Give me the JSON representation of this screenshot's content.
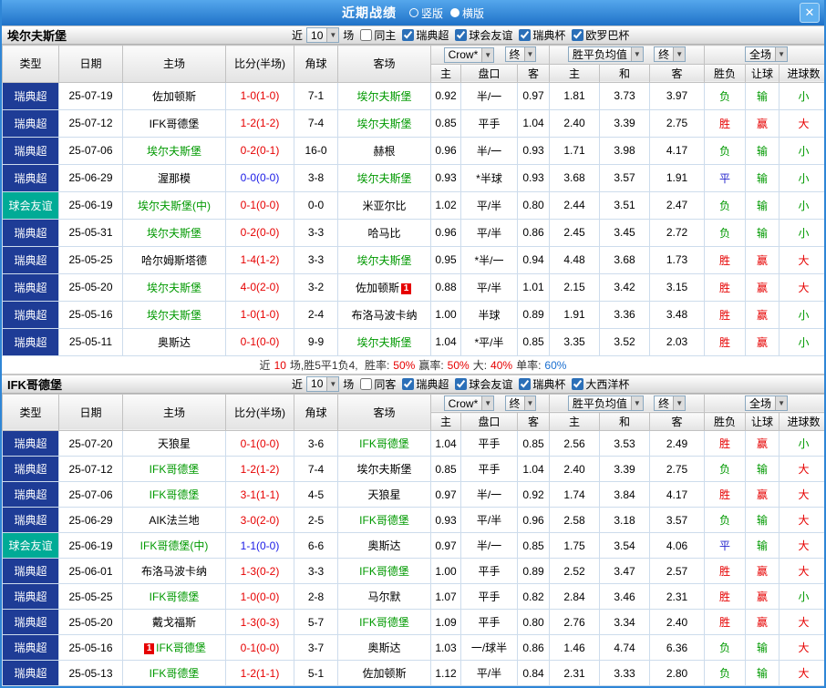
{
  "titlebar": {
    "title": "近期战绩",
    "radios": [
      {
        "label": "竖版",
        "selected": false
      },
      {
        "label": "横版",
        "selected": true
      }
    ],
    "close_label": "✕"
  },
  "colors": {
    "league_blue": "#1e3c96",
    "friendly_teal": "#00ab96",
    "focal_green": "#009900",
    "win_red": "#e60000",
    "draw_blue": "#2222cc",
    "titlebar_blue": "#1f72c8"
  },
  "columns": {
    "type": "类型",
    "date": "日期",
    "home": "主场",
    "score": "比分(半场)",
    "corner": "角球",
    "away": "客场",
    "asian_book": "Crow*",
    "asian_final": "终",
    "asian_cols": [
      "主",
      "盘口",
      "客"
    ],
    "europe_book": "胜平负均值",
    "europe_final": "终",
    "europe_cols": [
      "主",
      "和",
      "客"
    ],
    "scope": "全场",
    "result_cols": [
      "胜负",
      "让球",
      "进球数"
    ]
  },
  "sections": [
    {
      "team": "埃尔夫斯堡",
      "filter": {
        "prefix": "近",
        "count": "10",
        "suffix": "场",
        "checkboxes": [
          {
            "label": "同主",
            "checked": false
          },
          {
            "label": "瑞典超",
            "checked": true
          },
          {
            "label": "球会友谊",
            "checked": true
          },
          {
            "label": "瑞典杯",
            "checked": true
          },
          {
            "label": "欧罗巴杯",
            "checked": true
          }
        ]
      },
      "rows": [
        {
          "type": "瑞典超",
          "tc": "blue",
          "date": "25-07-19",
          "home": "佐加顿斯",
          "hf": false,
          "score": "1-0(1-0)",
          "sc": "red",
          "corner": "7-1",
          "away": "埃尔夫斯堡",
          "af": true,
          "odds": [
            "0.92",
            "半/一",
            "0.97",
            "1.81",
            "3.73",
            "3.97"
          ],
          "res": [
            [
              "负",
              "green"
            ],
            [
              "输",
              "green"
            ],
            [
              "小",
              "green"
            ]
          ]
        },
        {
          "type": "瑞典超",
          "tc": "blue",
          "date": "25-07-12",
          "home": "IFK哥德堡",
          "hf": false,
          "score": "1-2(1-2)",
          "sc": "red",
          "corner": "7-4",
          "away": "埃尔夫斯堡",
          "af": true,
          "odds": [
            "0.85",
            "平手",
            "1.04",
            "2.40",
            "3.39",
            "2.75"
          ],
          "res": [
            [
              "胜",
              "red"
            ],
            [
              "赢",
              "red"
            ],
            [
              "大",
              "red"
            ]
          ]
        },
        {
          "type": "瑞典超",
          "tc": "blue",
          "date": "25-07-06",
          "home": "埃尔夫斯堡",
          "hf": true,
          "score": "0-2(0-1)",
          "sc": "red",
          "corner": "16-0",
          "away": "赫根",
          "af": false,
          "odds": [
            "0.96",
            "半/一",
            "0.93",
            "1.71",
            "3.98",
            "4.17"
          ],
          "res": [
            [
              "负",
              "green"
            ],
            [
              "输",
              "green"
            ],
            [
              "小",
              "green"
            ]
          ]
        },
        {
          "type": "瑞典超",
          "tc": "blue",
          "date": "25-06-29",
          "home": "渥那模",
          "hf": false,
          "score": "0-0(0-0)",
          "sc": "blue",
          "corner": "3-8",
          "away": "埃尔夫斯堡",
          "af": true,
          "odds": [
            "0.93",
            "*半球",
            "0.93",
            "3.68",
            "3.57",
            "1.91"
          ],
          "res": [
            [
              "平",
              "blue"
            ],
            [
              "输",
              "green"
            ],
            [
              "小",
              "green"
            ]
          ]
        },
        {
          "type": "球会友谊",
          "tc": "teal",
          "date": "25-06-19",
          "home": "埃尔夫斯堡(中)",
          "hf": true,
          "score": "0-1(0-0)",
          "sc": "red",
          "corner": "0-0",
          "away": "米亚尔比",
          "af": false,
          "odds": [
            "1.02",
            "平/半",
            "0.80",
            "2.44",
            "3.51",
            "2.47"
          ],
          "res": [
            [
              "负",
              "green"
            ],
            [
              "输",
              "green"
            ],
            [
              "小",
              "green"
            ]
          ]
        },
        {
          "type": "瑞典超",
          "tc": "blue",
          "date": "25-05-31",
          "home": "埃尔夫斯堡",
          "hf": true,
          "score": "0-2(0-0)",
          "sc": "red",
          "corner": "3-3",
          "away": "哈马比",
          "af": false,
          "odds": [
            "0.96",
            "平/半",
            "0.86",
            "2.45",
            "3.45",
            "2.72"
          ],
          "res": [
            [
              "负",
              "green"
            ],
            [
              "输",
              "green"
            ],
            [
              "小",
              "green"
            ]
          ]
        },
        {
          "type": "瑞典超",
          "tc": "blue",
          "date": "25-05-25",
          "home": "哈尔姆斯塔德",
          "hf": false,
          "score": "1-4(1-2)",
          "sc": "red",
          "corner": "3-3",
          "away": "埃尔夫斯堡",
          "af": true,
          "odds": [
            "0.95",
            "*半/一",
            "0.94",
            "4.48",
            "3.68",
            "1.73"
          ],
          "res": [
            [
              "胜",
              "red"
            ],
            [
              "赢",
              "red"
            ],
            [
              "大",
              "red"
            ]
          ]
        },
        {
          "type": "瑞典超",
          "tc": "blue",
          "date": "25-05-20",
          "home": "埃尔夫斯堡",
          "hf": true,
          "score": "4-0(2-0)",
          "sc": "red",
          "corner": "3-2",
          "away": "佐加顿斯",
          "af": false,
          "away_card": "1",
          "odds": [
            "0.88",
            "平/半",
            "1.01",
            "2.15",
            "3.42",
            "3.15"
          ],
          "res": [
            [
              "胜",
              "red"
            ],
            [
              "赢",
              "red"
            ],
            [
              "大",
              "red"
            ]
          ]
        },
        {
          "type": "瑞典超",
          "tc": "blue",
          "date": "25-05-16",
          "home": "埃尔夫斯堡",
          "hf": true,
          "score": "1-0(1-0)",
          "sc": "red",
          "corner": "2-4",
          "away": "布洛马波卡纳",
          "af": false,
          "odds": [
            "1.00",
            "半球",
            "0.89",
            "1.91",
            "3.36",
            "3.48"
          ],
          "res": [
            [
              "胜",
              "red"
            ],
            [
              "赢",
              "red"
            ],
            [
              "小",
              "green"
            ]
          ]
        },
        {
          "type": "瑞典超",
          "tc": "blue",
          "date": "25-05-11",
          "home": "奥斯达",
          "hf": false,
          "score": "0-1(0-0)",
          "sc": "red",
          "corner": "9-9",
          "away": "埃尔夫斯堡",
          "af": true,
          "odds": [
            "1.04",
            "*平/半",
            "0.85",
            "3.35",
            "3.52",
            "2.03"
          ],
          "res": [
            [
              "胜",
              "red"
            ],
            [
              "赢",
              "red"
            ],
            [
              "小",
              "green"
            ]
          ]
        }
      ],
      "summary": [
        [
          "近",
          "k"
        ],
        [
          "10",
          "r"
        ],
        [
          "场,胜5平1负4, ",
          "k"
        ],
        [
          "胜率:",
          "k"
        ],
        [
          "50%",
          "r"
        ],
        [
          "赢率:",
          "k"
        ],
        [
          "50%",
          "r"
        ],
        [
          "大:",
          "k"
        ],
        [
          "40%",
          "r"
        ],
        [
          "单率:",
          "k"
        ],
        [
          "60%",
          "b"
        ]
      ]
    },
    {
      "team": "IFK哥德堡",
      "filter": {
        "prefix": "近",
        "count": "10",
        "suffix": "场",
        "checkboxes": [
          {
            "label": "同客",
            "checked": false
          },
          {
            "label": "瑞典超",
            "checked": true
          },
          {
            "label": "球会友谊",
            "checked": true
          },
          {
            "label": "瑞典杯",
            "checked": true
          },
          {
            "label": "大西洋杯",
            "checked": true
          }
        ]
      },
      "rows": [
        {
          "type": "瑞典超",
          "tc": "blue",
          "date": "25-07-20",
          "home": "天狼星",
          "hf": false,
          "score": "0-1(0-0)",
          "sc": "red",
          "corner": "3-6",
          "away": "IFK哥德堡",
          "af": true,
          "odds": [
            "1.04",
            "平手",
            "0.85",
            "2.56",
            "3.53",
            "2.49"
          ],
          "res": [
            [
              "胜",
              "red"
            ],
            [
              "赢",
              "red"
            ],
            [
              "小",
              "green"
            ]
          ]
        },
        {
          "type": "瑞典超",
          "tc": "blue",
          "date": "25-07-12",
          "home": "IFK哥德堡",
          "hf": true,
          "score": "1-2(1-2)",
          "sc": "red",
          "corner": "7-4",
          "away": "埃尔夫斯堡",
          "af": false,
          "odds": [
            "0.85",
            "平手",
            "1.04",
            "2.40",
            "3.39",
            "2.75"
          ],
          "res": [
            [
              "负",
              "green"
            ],
            [
              "输",
              "green"
            ],
            [
              "大",
              "red"
            ]
          ]
        },
        {
          "type": "瑞典超",
          "tc": "blue",
          "date": "25-07-06",
          "home": "IFK哥德堡",
          "hf": true,
          "score": "3-1(1-1)",
          "sc": "red",
          "corner": "4-5",
          "away": "天狼星",
          "af": false,
          "odds": [
            "0.97",
            "半/一",
            "0.92",
            "1.74",
            "3.84",
            "4.17"
          ],
          "res": [
            [
              "胜",
              "red"
            ],
            [
              "赢",
              "red"
            ],
            [
              "大",
              "red"
            ]
          ]
        },
        {
          "type": "瑞典超",
          "tc": "blue",
          "date": "25-06-29",
          "home": "AIK法兰地",
          "hf": false,
          "score": "3-0(2-0)",
          "sc": "red",
          "corner": "2-5",
          "away": "IFK哥德堡",
          "af": true,
          "odds": [
            "0.93",
            "平/半",
            "0.96",
            "2.58",
            "3.18",
            "3.57"
          ],
          "res": [
            [
              "负",
              "green"
            ],
            [
              "输",
              "green"
            ],
            [
              "大",
              "red"
            ]
          ]
        },
        {
          "type": "球会友谊",
          "tc": "teal",
          "date": "25-06-19",
          "home": "IFK哥德堡(中)",
          "hf": true,
          "score": "1-1(0-0)",
          "sc": "blue",
          "corner": "6-6",
          "away": "奥斯达",
          "af": false,
          "odds": [
            "0.97",
            "半/一",
            "0.85",
            "1.75",
            "3.54",
            "4.06"
          ],
          "res": [
            [
              "平",
              "blue"
            ],
            [
              "输",
              "green"
            ],
            [
              "大",
              "red"
            ]
          ]
        },
        {
          "type": "瑞典超",
          "tc": "blue",
          "date": "25-06-01",
          "home": "布洛马波卡纳",
          "hf": false,
          "score": "1-3(0-2)",
          "sc": "red",
          "corner": "3-3",
          "away": "IFK哥德堡",
          "af": true,
          "odds": [
            "1.00",
            "平手",
            "0.89",
            "2.52",
            "3.47",
            "2.57"
          ],
          "res": [
            [
              "胜",
              "red"
            ],
            [
              "赢",
              "red"
            ],
            [
              "大",
              "red"
            ]
          ]
        },
        {
          "type": "瑞典超",
          "tc": "blue",
          "date": "25-05-25",
          "home": "IFK哥德堡",
          "hf": true,
          "score": "1-0(0-0)",
          "sc": "red",
          "corner": "2-8",
          "away": "马尔默",
          "af": false,
          "odds": [
            "1.07",
            "平手",
            "0.82",
            "2.84",
            "3.46",
            "2.31"
          ],
          "res": [
            [
              "胜",
              "red"
            ],
            [
              "赢",
              "red"
            ],
            [
              "小",
              "green"
            ]
          ]
        },
        {
          "type": "瑞典超",
          "tc": "blue",
          "date": "25-05-20",
          "home": "戴戈福斯",
          "hf": false,
          "score": "1-3(0-3)",
          "sc": "red",
          "corner": "5-7",
          "away": "IFK哥德堡",
          "af": true,
          "odds": [
            "1.09",
            "平手",
            "0.80",
            "2.76",
            "3.34",
            "2.40"
          ],
          "res": [
            [
              "胜",
              "red"
            ],
            [
              "赢",
              "red"
            ],
            [
              "大",
              "red"
            ]
          ]
        },
        {
          "type": "瑞典超",
          "tc": "blue",
          "date": "25-05-16",
          "home": "IFK哥德堡",
          "hf": true,
          "home_card": "1",
          "home_card_pos": "before",
          "score": "0-1(0-0)",
          "sc": "red",
          "corner": "3-7",
          "away": "奥斯达",
          "af": false,
          "odds": [
            "1.03",
            "一/球半",
            "0.86",
            "1.46",
            "4.74",
            "6.36"
          ],
          "res": [
            [
              "负",
              "green"
            ],
            [
              "输",
              "green"
            ],
            [
              "大",
              "red"
            ]
          ]
        },
        {
          "type": "瑞典超",
          "tc": "blue",
          "date": "25-05-13",
          "home": "IFK哥德堡",
          "hf": true,
          "score": "1-2(1-1)",
          "sc": "red",
          "corner": "5-1",
          "away": "佐加顿斯",
          "af": false,
          "odds": [
            "1.12",
            "平/半",
            "0.84",
            "2.31",
            "3.33",
            "2.80"
          ],
          "res": [
            [
              "负",
              "green"
            ],
            [
              "输",
              "green"
            ],
            [
              "大",
              "red"
            ]
          ]
        }
      ]
    }
  ]
}
